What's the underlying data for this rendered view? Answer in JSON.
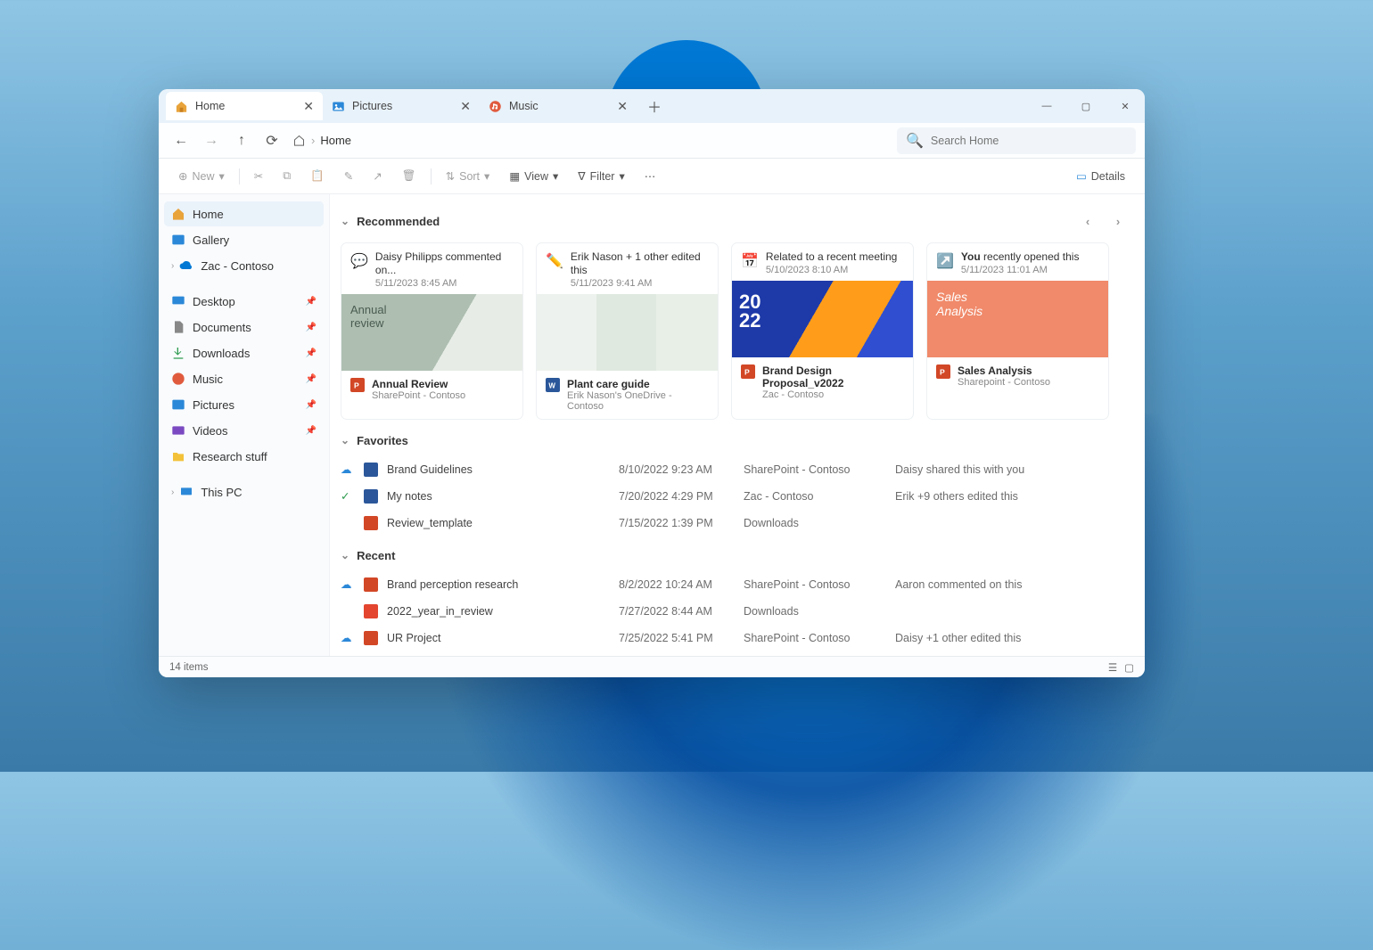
{
  "tabs": [
    {
      "label": "Home",
      "active": true
    },
    {
      "label": "Pictures",
      "active": false
    },
    {
      "label": "Music",
      "active": false
    }
  ],
  "breadcrumb": {
    "label": "Home"
  },
  "search": {
    "placeholder": "Search Home"
  },
  "toolbar": {
    "new": "New",
    "sort": "Sort",
    "view": "View",
    "filter": "Filter",
    "details": "Details"
  },
  "sidebar": {
    "home": "Home",
    "gallery": "Gallery",
    "account": "Zac - Contoso",
    "desktop": "Desktop",
    "documents": "Documents",
    "downloads": "Downloads",
    "music": "Music",
    "pictures": "Pictures",
    "videos": "Videos",
    "research": "Research stuff",
    "thispc": "This PC"
  },
  "sections": {
    "recommended": "Recommended",
    "favorites": "Favorites",
    "recent": "Recent"
  },
  "recommended": [
    {
      "head_line": "Daisy Philipps commented on...",
      "head_sub": "5/11/2023 8:45 AM",
      "title": "Annual Review",
      "sub": "SharePoint - Contoso"
    },
    {
      "head_line": "Erik Nason + 1 other edited this",
      "head_sub": "5/11/2023 9:41 AM",
      "title": "Plant care guide",
      "sub": "Erik Nason's OneDrive - Contoso"
    },
    {
      "head_line": "Related to a recent meeting",
      "head_sub": "5/10/2023 8:10 AM",
      "title": "Brand Design Proposal_v2022",
      "sub": "Zac - Contoso"
    },
    {
      "head_line": "You recently opened this",
      "head_sub": "5/11/2023 11:01 AM",
      "title": "Sales Analysis",
      "sub": "Sharepoint - Contoso"
    }
  ],
  "favorites": [
    {
      "name": "Brand Guidelines",
      "date": "8/10/2022 9:23 AM",
      "loc": "SharePoint - Contoso",
      "note": "Daisy shared this with you"
    },
    {
      "name": "My notes",
      "date": "7/20/2022 4:29 PM",
      "loc": "Zac - Contoso",
      "note": "Erik +9 others edited this"
    },
    {
      "name": "Review_template",
      "date": "7/15/2022 1:39 PM",
      "loc": "Downloads",
      "note": ""
    }
  ],
  "recent": [
    {
      "name": "Brand perception research",
      "date": "8/2/2022 10:24 AM",
      "loc": "SharePoint - Contoso",
      "note": "Aaron commented on this"
    },
    {
      "name": "2022_year_in_review",
      "date": "7/27/2022 8:44 AM",
      "loc": "Downloads",
      "note": ""
    },
    {
      "name": "UR Project",
      "date": "7/25/2022 5:41 PM",
      "loc": "SharePoint - Contoso",
      "note": "Daisy +1 other edited this"
    }
  ],
  "status": {
    "count": "14 items"
  }
}
